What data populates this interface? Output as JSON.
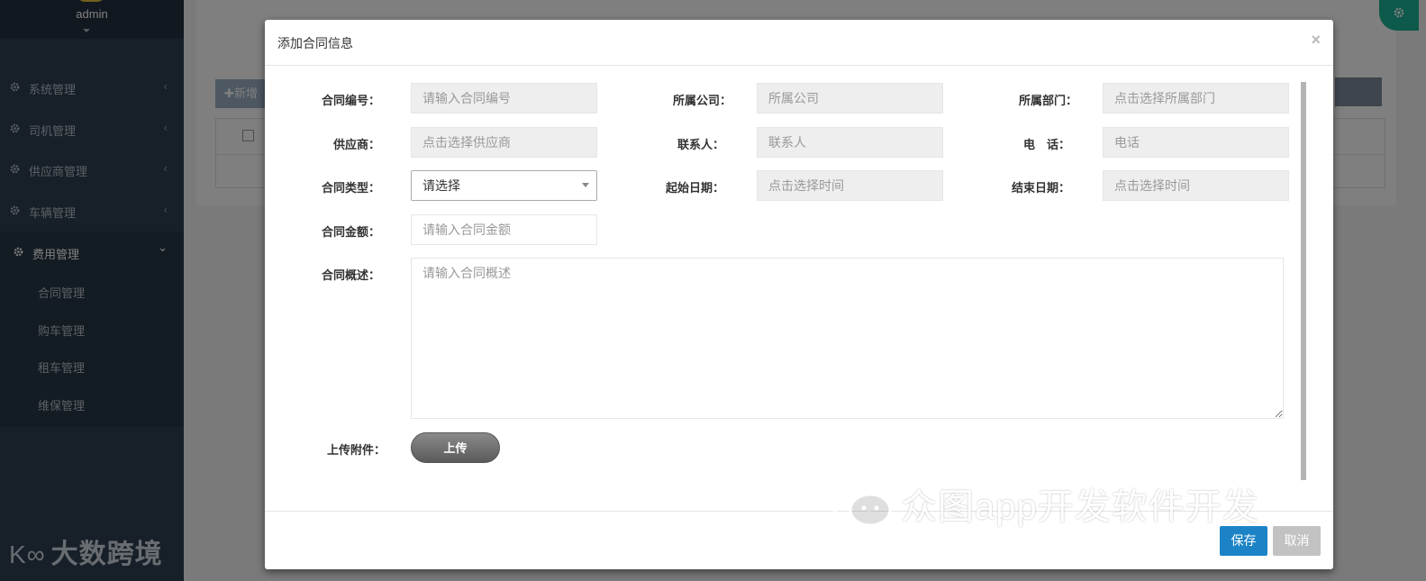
{
  "sidebar": {
    "user_name": "admin",
    "nav": [
      {
        "label": "系统管理",
        "chevron": "‹"
      },
      {
        "label": "司机管理",
        "chevron": "‹"
      },
      {
        "label": "供应商管理",
        "chevron": "‹"
      },
      {
        "label": "车辆管理",
        "chevron": "‹"
      },
      {
        "label": "费用管理",
        "chevron": "⌄"
      }
    ],
    "sub_items": [
      "合同管理",
      "购车管理",
      "租车管理",
      "维保管理"
    ],
    "brand": "大数跨境"
  },
  "background": {
    "add_button": "✚新增"
  },
  "modal": {
    "title": "添加合同信息",
    "close": "×",
    "fields": {
      "contract_no": {
        "label": "合同编号：",
        "placeholder": "请输入合同编号"
      },
      "company": {
        "label": "所属公司：",
        "placeholder": "所属公司"
      },
      "department": {
        "label": "所属部门：",
        "placeholder": "点击选择所属部门"
      },
      "supplier": {
        "label": "供应商：",
        "placeholder": "点击选择供应商"
      },
      "contact": {
        "label": "联系人：",
        "placeholder": "联系人"
      },
      "phone": {
        "label": "电　话：",
        "placeholder": "电话"
      },
      "type": {
        "label": "合同类型：",
        "value": "请选择"
      },
      "start_date": {
        "label": "起始日期：",
        "placeholder": "点击选择时间"
      },
      "end_date": {
        "label": "结束日期：",
        "placeholder": "点击选择时间"
      },
      "amount": {
        "label": "合同金额：",
        "placeholder": "请输入合同金额"
      },
      "summary": {
        "label": "合同概述：",
        "placeholder": "请输入合同概述"
      },
      "attachment": {
        "label": "上传附件：",
        "button": "上传"
      }
    },
    "footer": {
      "save": "保存",
      "cancel": "取消"
    }
  },
  "watermark": "众图app开发软件开发",
  "colors": {
    "sidebar": "#2f4050",
    "primary": "#1c84c6",
    "accent": "#1ab394"
  }
}
